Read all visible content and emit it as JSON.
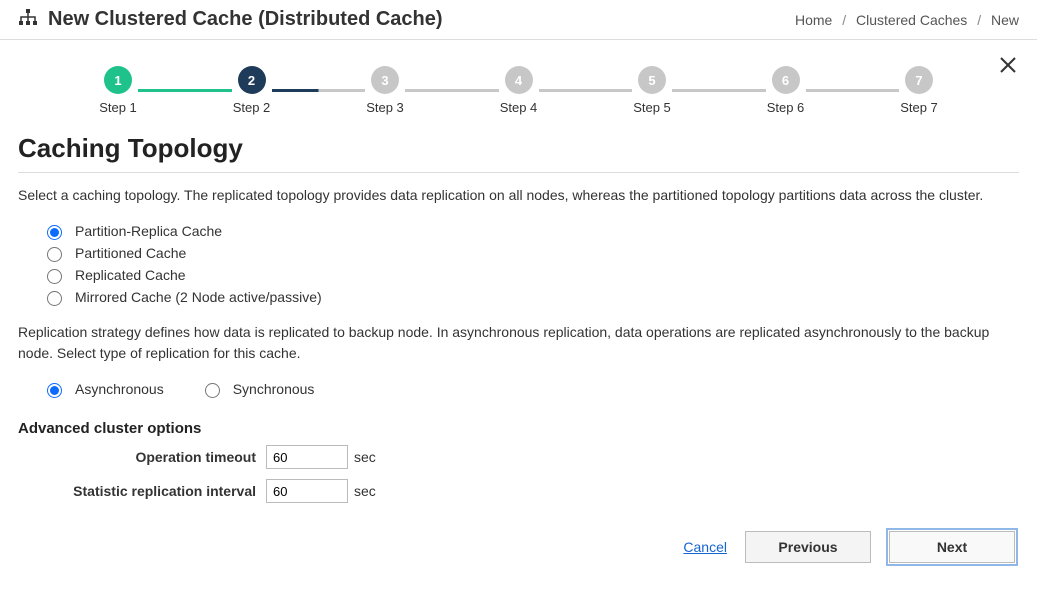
{
  "header": {
    "title": "New Clustered Cache (Distributed Cache)",
    "breadcrumb": {
      "home": "Home",
      "caches": "Clustered Caches",
      "new": "New"
    }
  },
  "steps": {
    "items": [
      {
        "num": "1",
        "label": "Step 1"
      },
      {
        "num": "2",
        "label": "Step 2"
      },
      {
        "num": "3",
        "label": "Step 3"
      },
      {
        "num": "4",
        "label": "Step 4"
      },
      {
        "num": "5",
        "label": "Step 5"
      },
      {
        "num": "6",
        "label": "Step 6"
      },
      {
        "num": "7",
        "label": "Step 7"
      }
    ]
  },
  "section": {
    "heading": "Caching Topology",
    "topology_desc": "Select a caching topology. The replicated topology provides data replication on all nodes, whereas the partitioned topology partitions data across the cluster.",
    "topology_options": {
      "partition_replica": "Partition-Replica Cache",
      "partitioned": "Partitioned Cache",
      "replicated": "Replicated Cache",
      "mirrored": "Mirrored Cache (2 Node active/passive)"
    },
    "replication_desc": "Replication strategy defines how data is replicated to backup node. In asynchronous replication, data operations are replicated asynchronously to the backup node. Select type of replication for this cache.",
    "replication_options": {
      "async": "Asynchronous",
      "sync": "Synchronous"
    },
    "advanced_heading": "Advanced cluster options",
    "operation_timeout_label": "Operation timeout",
    "operation_timeout_value": "60",
    "operation_timeout_unit": "sec",
    "stat_interval_label": "Statistic replication interval",
    "stat_interval_value": "60",
    "stat_interval_unit": "sec"
  },
  "footer": {
    "cancel": "Cancel",
    "previous": "Previous",
    "next": "Next"
  }
}
